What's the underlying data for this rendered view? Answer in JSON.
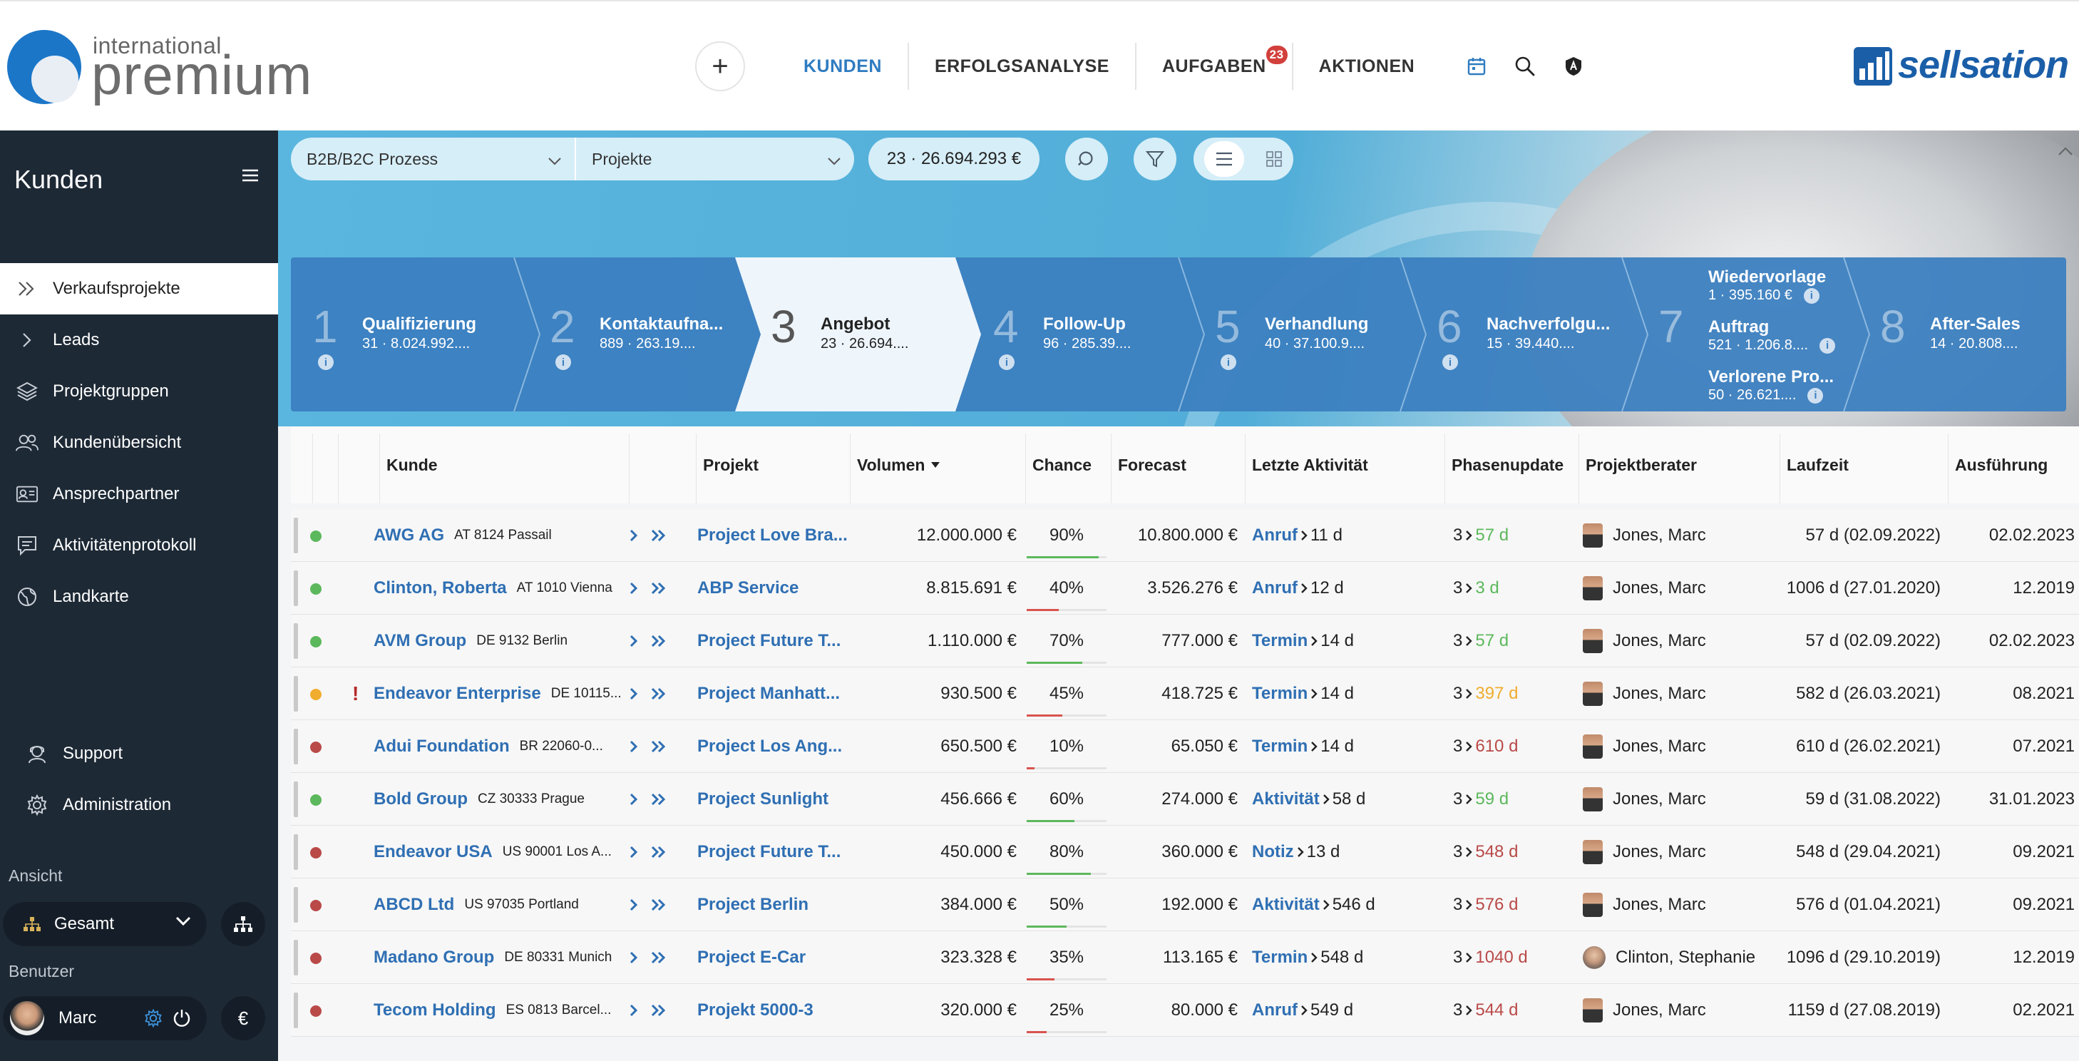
{
  "header": {
    "logo_small": "international",
    "logo_big": "premium",
    "brand": "sellsation",
    "add_label": "+",
    "nav": [
      {
        "label": "KUNDEN"
      },
      {
        "label": "ERFOLGSANALYSE"
      },
      {
        "label": "AUFGABEN",
        "badge": "23"
      },
      {
        "label": "AKTIONEN"
      }
    ]
  },
  "sidebar": {
    "title": "Kunden",
    "items": [
      {
        "label": "Verkaufsprojekte",
        "icon": "double-chevron-right-icon"
      },
      {
        "label": "Leads",
        "icon": "chevron-right-icon"
      },
      {
        "label": "Projektgruppen",
        "icon": "layers-icon"
      },
      {
        "label": "Kundenübersicht",
        "icon": "users-icon"
      },
      {
        "label": "Ansprechpartner",
        "icon": "contact-card-icon"
      },
      {
        "label": "Aktivitätenprotokoll",
        "icon": "chat-log-icon"
      },
      {
        "label": "Landkarte",
        "icon": "globe-icon"
      }
    ],
    "support": "Support",
    "administration": "Administration",
    "view_section": "Ansicht",
    "view_value": "Gesamt",
    "user_section": "Benutzer",
    "user_name": "Marc",
    "currency_symbol": "€"
  },
  "filters": {
    "process": "B2B/B2C Prozess",
    "type": "Projekte",
    "summary": "23 ·  26.694.293 €"
  },
  "stages": [
    {
      "num": "1",
      "name": "Qualifizierung",
      "vals": "31 ·  8.024.992...."
    },
    {
      "num": "2",
      "name": "Kontaktaufna...",
      "vals": "889 ·  263.19...."
    },
    {
      "num": "3",
      "name": "Angebot",
      "vals": "23 ·  26.694...."
    },
    {
      "num": "4",
      "name": "Follow-Up",
      "vals": "96 ·  285.39...."
    },
    {
      "num": "5",
      "name": "Verhandlung",
      "vals": "40 ·  37.100.9...."
    },
    {
      "num": "6",
      "name": "Nachverfolgu...",
      "vals": "15 ·  39.440...."
    },
    {
      "num": "7",
      "subs": [
        {
          "name": "Wiedervorlage",
          "vals": "1 ·  395.160 €"
        },
        {
          "name": "Auftrag",
          "vals": "521 ·  1.206.8...."
        },
        {
          "name": "Verlorene Pro...",
          "vals": "50 ·  26.621...."
        }
      ]
    },
    {
      "num": "8",
      "name": "After-Sales",
      "vals": "14 ·  20.808...."
    }
  ],
  "table": {
    "columns": [
      "Kunde",
      "Projekt",
      "Volumen",
      "Chance",
      "Forecast",
      "Letzte Aktivität",
      "Phasenupdate",
      "Projektberater",
      "Laufzeit",
      "Ausführung"
    ],
    "rows": [
      {
        "status": "#5cb85c",
        "flag": "",
        "name": "AWG AG",
        "loc": "AT 8124 Passail",
        "project": "Project Love Bra...",
        "volume": "12.000.000 €",
        "chance": "90%",
        "chance_pct": 90,
        "forecast": "10.800.000 €",
        "act": "Anruf",
        "act_days": "11 d",
        "phase_from": "3",
        "phase_days": "57 d",
        "phase_color": "#5cb85c",
        "advisor": "Jones, Marc",
        "advisor_f": false,
        "laufzeit": "57 d (02.09.2022)",
        "ausf": "02.02.2023"
      },
      {
        "status": "#5cb85c",
        "flag": "",
        "name": "Clinton, Roberta",
        "loc": "AT 1010 Vienna",
        "project": "ABP Service",
        "volume": "8.815.691 €",
        "chance": "40%",
        "chance_pct": 40,
        "forecast": "3.526.276 €",
        "act": "Anruf",
        "act_days": "12 d",
        "phase_from": "3",
        "phase_days": "3 d",
        "phase_color": "#5cb85c",
        "advisor": "Jones, Marc",
        "advisor_f": false,
        "laufzeit": "1006 d (27.01.2020)",
        "ausf": "12.2019"
      },
      {
        "status": "#5cb85c",
        "flag": "",
        "name": "AVM Group",
        "loc": "DE 9132 Berlin",
        "project": "Project Future T...",
        "volume": "1.110.000 €",
        "chance": "70%",
        "chance_pct": 70,
        "forecast": "777.000 €",
        "act": "Termin",
        "act_days": "14 d",
        "phase_from": "3",
        "phase_days": "57 d",
        "phase_color": "#5cb85c",
        "advisor": "Jones, Marc",
        "advisor_f": false,
        "laufzeit": "57 d (02.09.2022)",
        "ausf": "02.02.2023"
      },
      {
        "status": "#f0ad2f",
        "flag": "!",
        "name": "Endeavor Enterprise",
        "loc": "DE 10115...",
        "project": "Project Manhatt...",
        "volume": "930.500 €",
        "chance": "45%",
        "chance_pct": 45,
        "forecast": "418.725 €",
        "act": "Termin",
        "act_days": "14 d",
        "phase_from": "3",
        "phase_days": "397 d",
        "phase_color": "#f0ad2f",
        "advisor": "Jones, Marc",
        "advisor_f": false,
        "laufzeit": "582 d (26.03.2021)",
        "ausf": "08.2021"
      },
      {
        "status": "#b94a48",
        "flag": "",
        "name": "Adui Foundation",
        "loc": "BR 22060-0...",
        "project": "Project Los Ang...",
        "volume": "650.500 €",
        "chance": "10%",
        "chance_pct": 10,
        "forecast": "65.050 €",
        "act": "Termin",
        "act_days": "14 d",
        "phase_from": "3",
        "phase_days": "610 d",
        "phase_color": "#b94a48",
        "advisor": "Jones, Marc",
        "advisor_f": false,
        "laufzeit": "610 d (26.02.2021)",
        "ausf": "07.2021"
      },
      {
        "status": "#5cb85c",
        "flag": "",
        "name": "Bold Group",
        "loc": "CZ 30333 Prague",
        "project": "Project Sunlight",
        "volume": "456.666 €",
        "chance": "60%",
        "chance_pct": 60,
        "forecast": "274.000 €",
        "act": "Aktivität",
        "act_days": "58 d",
        "phase_from": "3",
        "phase_days": "59 d",
        "phase_color": "#5cb85c",
        "advisor": "Jones, Marc",
        "advisor_f": false,
        "laufzeit": "59 d (31.08.2022)",
        "ausf": "31.01.2023"
      },
      {
        "status": "#b94a48",
        "flag": "",
        "name": "Endeavor USA",
        "loc": "US 90001 Los A...",
        "project": "Project Future T...",
        "volume": "450.000 €",
        "chance": "80%",
        "chance_pct": 80,
        "forecast": "360.000 €",
        "act": "Notiz",
        "act_days": "13 d",
        "phase_from": "3",
        "phase_days": "548 d",
        "phase_color": "#b94a48",
        "advisor": "Jones, Marc",
        "advisor_f": false,
        "laufzeit": "548 d (29.04.2021)",
        "ausf": "09.2021"
      },
      {
        "status": "#b94a48",
        "flag": "",
        "name": "ABCD Ltd",
        "loc": "US 97035 Portland",
        "project": "Project Berlin",
        "volume": "384.000 €",
        "chance": "50%",
        "chance_pct": 50,
        "forecast": "192.000 €",
        "act": "Aktivität",
        "act_days": "546 d",
        "phase_from": "3",
        "phase_days": "576 d",
        "phase_color": "#b94a48",
        "advisor": "Jones, Marc",
        "advisor_f": false,
        "laufzeit": "576 d (01.04.2021)",
        "ausf": "09.2021"
      },
      {
        "status": "#b94a48",
        "flag": "",
        "name": "Madano Group",
        "loc": "DE 80331 Munich",
        "project": "Project E-Car",
        "volume": "323.328 €",
        "chance": "35%",
        "chance_pct": 35,
        "forecast": "113.165 €",
        "act": "Termin",
        "act_days": "548 d",
        "phase_from": "3",
        "phase_days": "1040 d",
        "phase_color": "#b94a48",
        "advisor": "Clinton, Stephanie",
        "advisor_f": true,
        "laufzeit": "1096 d (29.10.2019)",
        "ausf": "12.2019"
      },
      {
        "status": "#b94a48",
        "flag": "",
        "name": "Tecom Holding",
        "loc": "ES 0813 Barcel...",
        "project": "Projekt 5000-3",
        "volume": "320.000 €",
        "chance": "25%",
        "chance_pct": 25,
        "forecast": "80.000 €",
        "act": "Anruf",
        "act_days": "549 d",
        "phase_from": "3",
        "phase_days": "544 d",
        "phase_color": "#b94a48",
        "advisor": "Jones, Marc",
        "advisor_f": false,
        "laufzeit": "1159 d (27.08.2019)",
        "ausf": "02.2021"
      }
    ]
  }
}
